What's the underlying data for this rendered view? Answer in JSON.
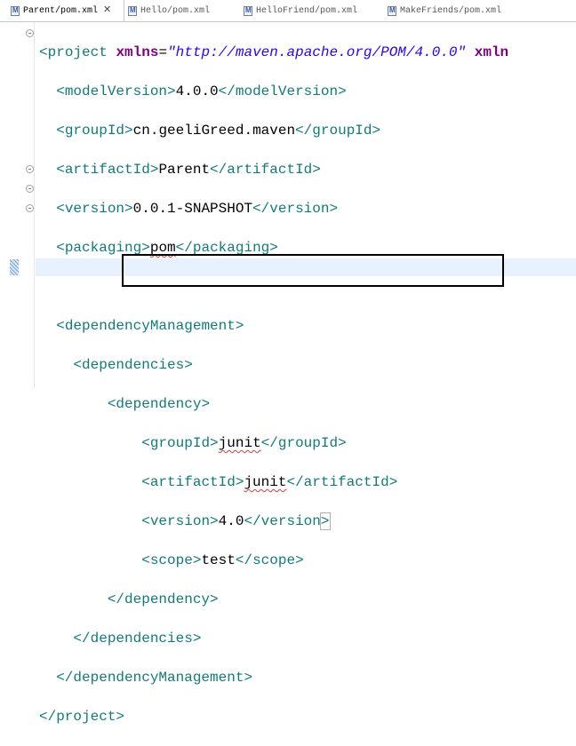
{
  "tabs": [
    {
      "label": "Parent/pom.xml",
      "active": true,
      "close": "✕"
    },
    {
      "label": "Hello/pom.xml",
      "active": false
    },
    {
      "label": "HelloFriend/pom.xml",
      "active": false
    },
    {
      "label": "MakeFriends/pom.xml",
      "active": false
    }
  ],
  "code": {
    "project_open": "project",
    "xmlns_attr": "xmlns",
    "xmlns_value": "\"http://maven.apache.org/POM/4.0.0\"",
    "xmlns_trail": "xmln",
    "modelVersion_tag": "modelVersion",
    "modelVersion_value": "4.0.0",
    "groupId_tag": "groupId",
    "groupId_value": "cn.geeliGreed.maven",
    "artifactId_tag": "artifactId",
    "artifactId_value": "Parent",
    "version_tag": "version",
    "version_value": "0.0.1-SNAPSHOT",
    "packaging_tag": "packaging",
    "packaging_value": "pom",
    "depMgmt_tag": "dependencyManagement",
    "dependencies_tag": "dependencies",
    "dependency_tag": "dependency",
    "dep_groupId_value": "junit",
    "dep_artifactId_value": "junit",
    "dep_version_value": "4.0",
    "scope_tag": "scope",
    "scope_value": "test"
  }
}
